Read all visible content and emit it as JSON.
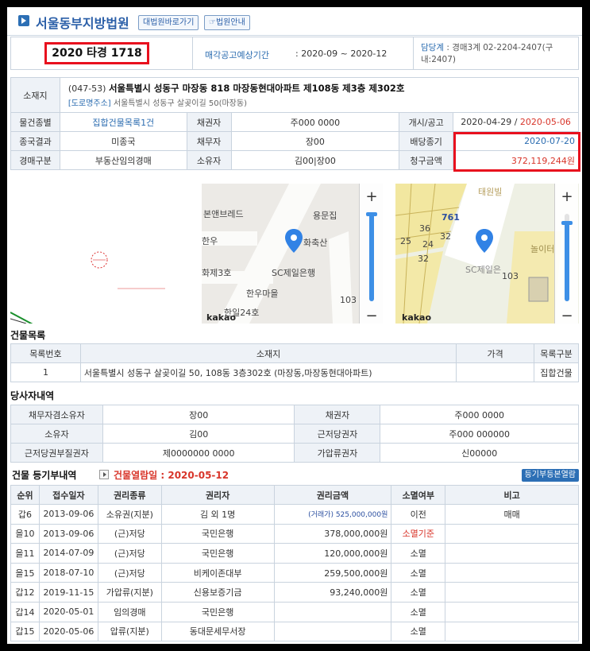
{
  "header": {
    "court_name": "서울동부지방법원",
    "btn_supreme": "대법원바로가기",
    "btn_court_info": "법원안내"
  },
  "case": {
    "number": "2020 타경 1718",
    "notice_label": "매각공고예상기간",
    "notice_value": "2020-09 ~ 2020-12",
    "dept_label": "담당계",
    "dept_value": "경매3계 02-2204-2407(구내:2407)"
  },
  "property": {
    "location_label": "소재지",
    "address_prefix": "(047-53)",
    "address": "서울특별시 성동구 마장동 818 마장동현대아파트 제108동 제3층 제302호",
    "road_label": "[도로명주소]",
    "road_address": "서울특별시 성동구 살곶이길 50(마장동)",
    "rows": [
      [
        {
          "label": "물건종별",
          "value": "집합건물목록1건"
        },
        {
          "label": "채권자",
          "value": "주000 0000"
        },
        {
          "label": "개시/공고",
          "value1": "2020-04-29",
          "value2": "2020-05-06"
        }
      ],
      [
        {
          "label": "종국결과",
          "value": "미종국"
        },
        {
          "label": "채무자",
          "value": "장00"
        },
        {
          "label": "배당종기",
          "value": "2020-07-20"
        }
      ],
      [
        {
          "label": "경매구분",
          "value": "부동산임의경매"
        },
        {
          "label": "소유자",
          "value": "김00|장00"
        },
        {
          "label": "청구금액",
          "value": "372,119,244원"
        }
      ]
    ]
  },
  "map_labels": {
    "m1": [
      "본앤브레드",
      "용문집",
      "한우",
      "화축산",
      "SC제일은행",
      "화제3호",
      "한우마을",
      "한일24호",
      "103"
    ],
    "m2": [
      "태원빌",
      "761",
      "36",
      "25",
      "32",
      "24",
      "32",
      "103",
      "SC제일은",
      "놀이터"
    ],
    "kakao": "kakao"
  },
  "building": {
    "section_title": "건물목록",
    "headers": [
      "목록번호",
      "소재지",
      "가격",
      "목록구분"
    ],
    "rows": [
      [
        "1",
        "서울특별시 성동구 살곶이길 50, 108동 3층302호 (마장동,마장동현대아파트)",
        "",
        "집합건물"
      ]
    ]
  },
  "parties": {
    "section_title": "당사자내역",
    "rows": [
      [
        "채무자겸소유자",
        "장00",
        "채권자",
        "주000 0000"
      ],
      [
        "소유자",
        "김00",
        "근저당권자",
        "주000 000000"
      ],
      [
        "근저당권부질권자",
        "제0000000 0000",
        "가압류권자",
        "신00000"
      ]
    ]
  },
  "registry": {
    "section_title": "건물 등기부내역",
    "viewed_label": "건물열람일 : 2020-05-12",
    "button": "등기부등본열람",
    "headers": [
      "순위",
      "접수일자",
      "권리종류",
      "권리자",
      "권리금액",
      "소멸여부",
      "비고"
    ],
    "rows": [
      [
        "갑6",
        "2013-09-06",
        "소유권(지분)",
        "김      외 1명",
        "(거래가) 525,000,000원",
        "이전",
        "매매"
      ],
      [
        "을10",
        "2013-09-06",
        "(근)저당",
        "국민은행",
        "378,000,000원",
        "소멸기준",
        ""
      ],
      [
        "을11",
        "2014-07-09",
        "(근)저당",
        "국민은행",
        "120,000,000원",
        "소멸",
        ""
      ],
      [
        "을15",
        "2018-07-10",
        "(근)저당",
        "비케이존대부",
        "259,500,000원",
        "소멸",
        ""
      ],
      [
        "갑12",
        "2019-11-15",
        "가압류(지분)",
        "신용보증기금",
        "93,240,000원",
        "소멸",
        ""
      ],
      [
        "갑14",
        "2020-05-01",
        "임의경매",
        "국민은행",
        "",
        "소멸",
        ""
      ],
      [
        "갑15",
        "2020-05-06",
        "압류(지분)",
        "동대문세무서장",
        "",
        "소멸",
        ""
      ]
    ]
  },
  "colors": {
    "accent_blue": "#2b6cb0",
    "highlight_red": "#e8101e",
    "date_red": "#d8352a",
    "label_bg": "#eef2f7"
  }
}
